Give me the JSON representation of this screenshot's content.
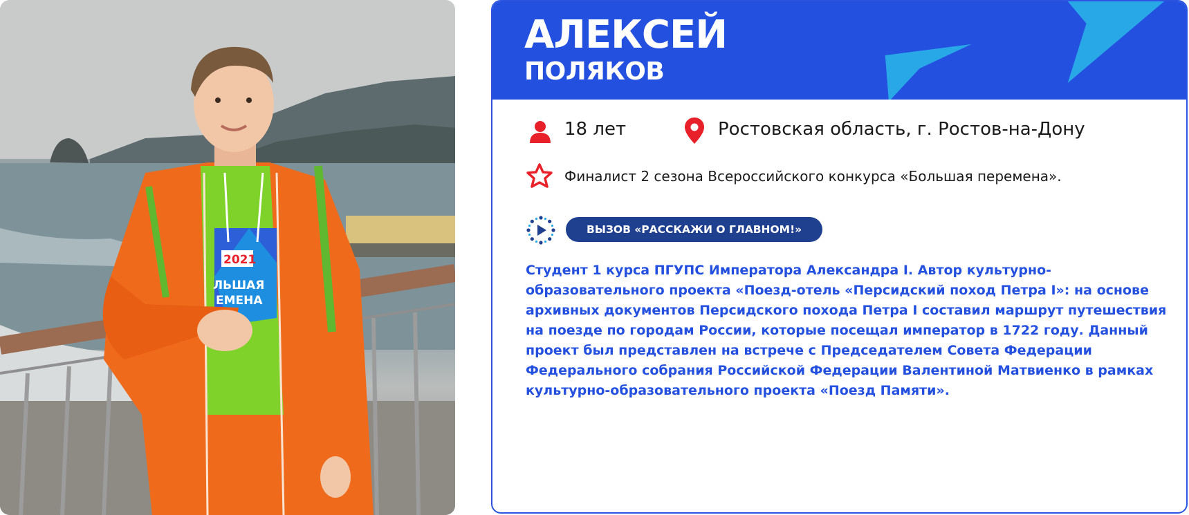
{
  "person": {
    "first_name": "АЛЕКСЕЙ",
    "last_name": "ПОЛЯКОВ",
    "age": "18 лет",
    "location": "Ростовская область, г. Ростов-на-Дону",
    "status": "Финалист 2 сезона Всероссийского конкурса «Большая перемена».",
    "challenge": "ВЫЗОВ «РАССКАЖИ О ГЛАВНОМ!»",
    "bio": "Студент 1 курса ПГУПС Императора Александра I. Автор культурно-образовательного проекта «Поезд-отель «Персидский поход Петра I»: на основе архивных документов Персидского похода Петра I составил маршрут путешествия на поезде по городам России, которые посещал император в 1722 году. Данный проект был представлен на встрече с Председателем Совета Федерации Федерального собрания Российской Федерации Валентиной Матвиенко в рамках культурно-образовательного проекта «Поезд Памяти»."
  },
  "photo": {
    "hoodie_print": [
      "2021",
      "ЛЬШАЯ",
      "ЕМЕНА"
    ]
  },
  "icons": {
    "age": "person-icon",
    "location": "map-pin-icon",
    "status": "star-icon",
    "challenge": "play-circle-icon"
  },
  "colors": {
    "header_bg": "#2450e0",
    "accent_light_blue": "#29a8e8",
    "icon_red": "#e8202a",
    "badge_bg": "#1f3f8f",
    "bio_text": "#2450e0"
  }
}
